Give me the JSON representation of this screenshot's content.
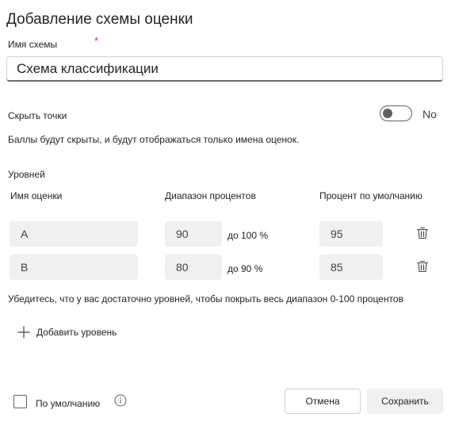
{
  "dialog": {
    "title": "Добавление схемы оценки",
    "scheme_name_label": "Имя схемы",
    "required_mark": "*",
    "scheme_name_value": "Схема классификации",
    "hide_points_label": "Скрыть точки",
    "hide_points_state": "No",
    "hide_points_description": "Баллы будут скрыты, и будут отображаться только имена оценок.",
    "levels_label": "Уровней",
    "columns": {
      "grade_name": "Имя оценки",
      "percent_range": "Диапазон процентов",
      "default_percent": "Процент по умолчанию"
    },
    "levels": [
      {
        "name": "A",
        "range_from": "90",
        "range_to": "до 100 %",
        "default": "95"
      },
      {
        "name": "B",
        "range_from": "80",
        "range_to": "до 90 %",
        "default": "85"
      }
    ],
    "coverage_hint": "Убедитесь, что у вас достаточно уровней, чтобы покрыть весь диапазон 0-100 процентов",
    "add_level_label": "Добавить уровень",
    "default_checkbox_label": "По умолчанию",
    "cancel_label": "Отмена",
    "save_label": "Сохранить"
  },
  "colors": {
    "required": "#c4314b",
    "field_bg": "#f0f0f0",
    "toggle": "#616161"
  }
}
